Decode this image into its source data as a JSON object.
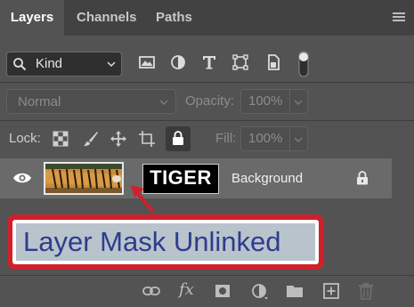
{
  "tabs": [
    {
      "label": "Layers",
      "active": true
    },
    {
      "label": "Channels",
      "active": false
    },
    {
      "label": "Paths",
      "active": false
    }
  ],
  "filter": {
    "kind_label": "Kind",
    "icons": [
      "image-filter-icon",
      "adjustment-filter-icon",
      "type-filter-icon",
      "shape-filter-icon",
      "smart-object-filter-icon",
      "filter-toggle-icon"
    ]
  },
  "blend": {
    "mode": "Normal",
    "opacity_label": "Opacity:",
    "opacity_value": "100%"
  },
  "lock": {
    "label": "Lock:",
    "fill_label": "Fill:",
    "fill_value": "100%"
  },
  "layer": {
    "name": "Background",
    "mask_text": "TIGER",
    "visible": true,
    "locked": true
  },
  "annotation": {
    "text": "Layer Mask Unlinked",
    "border_color": "#d0202c",
    "text_color": "#2e3d8c"
  },
  "bottom_bar": {
    "fx_label": "fx",
    "icons": [
      "link-layers-icon",
      "layer-style-icon",
      "add-mask-icon",
      "adjustment-layer-icon",
      "new-group-icon",
      "new-layer-icon",
      "delete-layer-icon"
    ]
  },
  "colors": {
    "panel_bg": "#535353",
    "tab_bar_bg": "#424242",
    "selected_layer_bg": "#6a6a6a"
  }
}
